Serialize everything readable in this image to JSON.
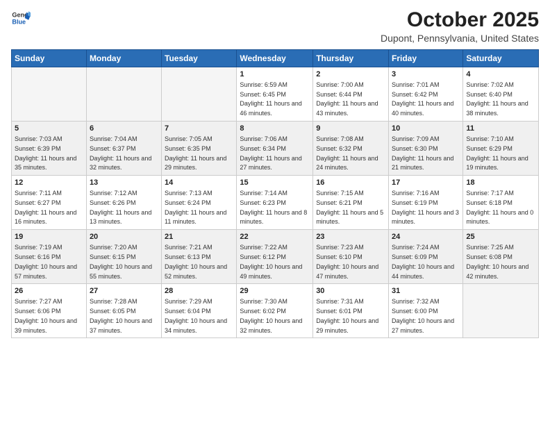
{
  "logo": {
    "general": "General",
    "blue": "Blue"
  },
  "title": "October 2025",
  "subtitle": "Dupont, Pennsylvania, United States",
  "days_of_week": [
    "Sunday",
    "Monday",
    "Tuesday",
    "Wednesday",
    "Thursday",
    "Friday",
    "Saturday"
  ],
  "weeks": [
    [
      {
        "day": "",
        "empty": true
      },
      {
        "day": "",
        "empty": true
      },
      {
        "day": "",
        "empty": true
      },
      {
        "day": "1",
        "sunrise": "6:59 AM",
        "sunset": "6:45 PM",
        "daylight": "11 hours and 46 minutes."
      },
      {
        "day": "2",
        "sunrise": "7:00 AM",
        "sunset": "6:44 PM",
        "daylight": "11 hours and 43 minutes."
      },
      {
        "day": "3",
        "sunrise": "7:01 AM",
        "sunset": "6:42 PM",
        "daylight": "11 hours and 40 minutes."
      },
      {
        "day": "4",
        "sunrise": "7:02 AM",
        "sunset": "6:40 PM",
        "daylight": "11 hours and 38 minutes."
      }
    ],
    [
      {
        "day": "5",
        "sunrise": "7:03 AM",
        "sunset": "6:39 PM",
        "daylight": "11 hours and 35 minutes."
      },
      {
        "day": "6",
        "sunrise": "7:04 AM",
        "sunset": "6:37 PM",
        "daylight": "11 hours and 32 minutes."
      },
      {
        "day": "7",
        "sunrise": "7:05 AM",
        "sunset": "6:35 PM",
        "daylight": "11 hours and 29 minutes."
      },
      {
        "day": "8",
        "sunrise": "7:06 AM",
        "sunset": "6:34 PM",
        "daylight": "11 hours and 27 minutes."
      },
      {
        "day": "9",
        "sunrise": "7:08 AM",
        "sunset": "6:32 PM",
        "daylight": "11 hours and 24 minutes."
      },
      {
        "day": "10",
        "sunrise": "7:09 AM",
        "sunset": "6:30 PM",
        "daylight": "11 hours and 21 minutes."
      },
      {
        "day": "11",
        "sunrise": "7:10 AM",
        "sunset": "6:29 PM",
        "daylight": "11 hours and 19 minutes."
      }
    ],
    [
      {
        "day": "12",
        "sunrise": "7:11 AM",
        "sunset": "6:27 PM",
        "daylight": "11 hours and 16 minutes."
      },
      {
        "day": "13",
        "sunrise": "7:12 AM",
        "sunset": "6:26 PM",
        "daylight": "11 hours and 13 minutes."
      },
      {
        "day": "14",
        "sunrise": "7:13 AM",
        "sunset": "6:24 PM",
        "daylight": "11 hours and 11 minutes."
      },
      {
        "day": "15",
        "sunrise": "7:14 AM",
        "sunset": "6:23 PM",
        "daylight": "11 hours and 8 minutes."
      },
      {
        "day": "16",
        "sunrise": "7:15 AM",
        "sunset": "6:21 PM",
        "daylight": "11 hours and 5 minutes."
      },
      {
        "day": "17",
        "sunrise": "7:16 AM",
        "sunset": "6:19 PM",
        "daylight": "11 hours and 3 minutes."
      },
      {
        "day": "18",
        "sunrise": "7:17 AM",
        "sunset": "6:18 PM",
        "daylight": "11 hours and 0 minutes."
      }
    ],
    [
      {
        "day": "19",
        "sunrise": "7:19 AM",
        "sunset": "6:16 PM",
        "daylight": "10 hours and 57 minutes."
      },
      {
        "day": "20",
        "sunrise": "7:20 AM",
        "sunset": "6:15 PM",
        "daylight": "10 hours and 55 minutes."
      },
      {
        "day": "21",
        "sunrise": "7:21 AM",
        "sunset": "6:13 PM",
        "daylight": "10 hours and 52 minutes."
      },
      {
        "day": "22",
        "sunrise": "7:22 AM",
        "sunset": "6:12 PM",
        "daylight": "10 hours and 49 minutes."
      },
      {
        "day": "23",
        "sunrise": "7:23 AM",
        "sunset": "6:10 PM",
        "daylight": "10 hours and 47 minutes."
      },
      {
        "day": "24",
        "sunrise": "7:24 AM",
        "sunset": "6:09 PM",
        "daylight": "10 hours and 44 minutes."
      },
      {
        "day": "25",
        "sunrise": "7:25 AM",
        "sunset": "6:08 PM",
        "daylight": "10 hours and 42 minutes."
      }
    ],
    [
      {
        "day": "26",
        "sunrise": "7:27 AM",
        "sunset": "6:06 PM",
        "daylight": "10 hours and 39 minutes."
      },
      {
        "day": "27",
        "sunrise": "7:28 AM",
        "sunset": "6:05 PM",
        "daylight": "10 hours and 37 minutes."
      },
      {
        "day": "28",
        "sunrise": "7:29 AM",
        "sunset": "6:04 PM",
        "daylight": "10 hours and 34 minutes."
      },
      {
        "day": "29",
        "sunrise": "7:30 AM",
        "sunset": "6:02 PM",
        "daylight": "10 hours and 32 minutes."
      },
      {
        "day": "30",
        "sunrise": "7:31 AM",
        "sunset": "6:01 PM",
        "daylight": "10 hours and 29 minutes."
      },
      {
        "day": "31",
        "sunrise": "7:32 AM",
        "sunset": "6:00 PM",
        "daylight": "10 hours and 27 minutes."
      },
      {
        "day": "",
        "empty": true
      }
    ]
  ]
}
